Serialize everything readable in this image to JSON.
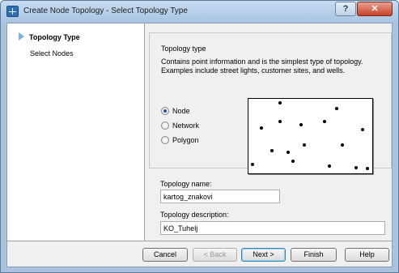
{
  "window": {
    "title": "Create Node Topology - Select Topology Type",
    "help_glyph": "?",
    "close_glyph": "✕"
  },
  "steps": [
    {
      "label": "Topology Type",
      "active": true
    },
    {
      "label": "Select Nodes",
      "active": false
    }
  ],
  "topology_type": {
    "group_title": "Topology type",
    "description": "Contains point information and is the simplest type of topology. Examples include street lights, customer sites, and wells.",
    "options": [
      {
        "label": "Node",
        "checked": true
      },
      {
        "label": "Network",
        "checked": false
      },
      {
        "label": "Polygon",
        "checked": false
      }
    ]
  },
  "fields": {
    "name_label": "Topology name:",
    "name_value": "kartog_znakovi",
    "description_label": "Topology description:",
    "description_value": "KO_Tuhelj"
  },
  "buttons": {
    "cancel": "Cancel",
    "back": "< Back",
    "next": "Next >",
    "finish": "Finish",
    "help": "Help"
  },
  "colors": {
    "accent": "#7ab2e2",
    "window_frame": "#a9c3de"
  }
}
